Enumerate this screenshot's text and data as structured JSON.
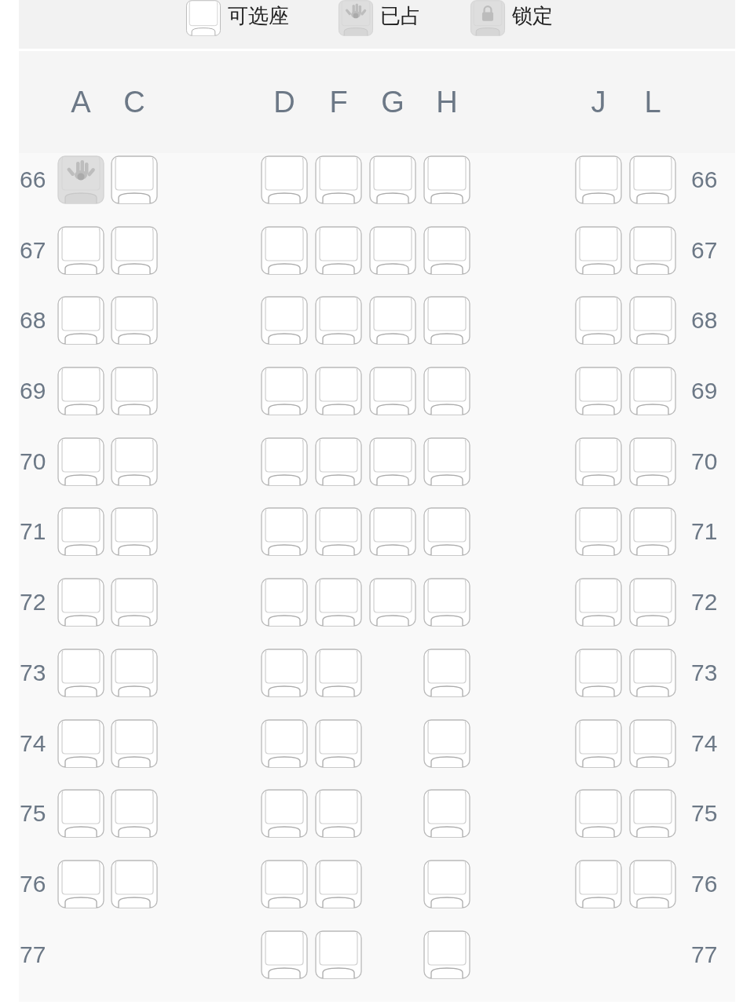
{
  "legend": [
    {
      "kind": "available",
      "label": "可选座"
    },
    {
      "kind": "occupied",
      "label": "已占"
    },
    {
      "kind": "locked",
      "label": "锁定"
    }
  ],
  "column_groups": [
    [
      "A",
      "C"
    ],
    [
      "D",
      "F",
      "G",
      "H"
    ],
    [
      "J",
      "L"
    ]
  ],
  "rows": [
    {
      "left_number": "66",
      "right_number": "66",
      "blocks": [
        [
          {
            "kind": "seat",
            "occupied": true
          },
          {
            "kind": "seat",
            "occupied": false
          }
        ],
        [
          {
            "kind": "seat",
            "occupied": false
          },
          {
            "kind": "seat",
            "occupied": false
          },
          {
            "kind": "seat",
            "occupied": false
          },
          {
            "kind": "seat",
            "occupied": false
          }
        ],
        [
          {
            "kind": "seat",
            "occupied": false
          },
          {
            "kind": "seat",
            "occupied": false
          }
        ]
      ]
    },
    {
      "left_number": "67",
      "right_number": "67",
      "blocks": [
        [
          {
            "kind": "seat",
            "occupied": false
          },
          {
            "kind": "seat",
            "occupied": false
          }
        ],
        [
          {
            "kind": "seat",
            "occupied": false
          },
          {
            "kind": "seat",
            "occupied": false
          },
          {
            "kind": "seat",
            "occupied": false
          },
          {
            "kind": "seat",
            "occupied": false
          }
        ],
        [
          {
            "kind": "seat",
            "occupied": false
          },
          {
            "kind": "seat",
            "occupied": false
          }
        ]
      ]
    },
    {
      "left_number": "68",
      "right_number": "68",
      "blocks": [
        [
          {
            "kind": "seat",
            "occupied": false
          },
          {
            "kind": "seat",
            "occupied": false
          }
        ],
        [
          {
            "kind": "seat",
            "occupied": false
          },
          {
            "kind": "seat",
            "occupied": false
          },
          {
            "kind": "seat",
            "occupied": false
          },
          {
            "kind": "seat",
            "occupied": false
          }
        ],
        [
          {
            "kind": "seat",
            "occupied": false
          },
          {
            "kind": "seat",
            "occupied": false
          }
        ]
      ]
    },
    {
      "left_number": "69",
      "right_number": "69",
      "blocks": [
        [
          {
            "kind": "seat",
            "occupied": false
          },
          {
            "kind": "seat",
            "occupied": false
          }
        ],
        [
          {
            "kind": "seat",
            "occupied": false
          },
          {
            "kind": "seat",
            "occupied": false
          },
          {
            "kind": "seat",
            "occupied": false
          },
          {
            "kind": "seat",
            "occupied": false
          }
        ],
        [
          {
            "kind": "seat",
            "occupied": false
          },
          {
            "kind": "seat",
            "occupied": false
          }
        ]
      ]
    },
    {
      "left_number": "70",
      "right_number": "70",
      "blocks": [
        [
          {
            "kind": "seat",
            "occupied": false
          },
          {
            "kind": "seat",
            "occupied": false
          }
        ],
        [
          {
            "kind": "seat",
            "occupied": false
          },
          {
            "kind": "seat",
            "occupied": false
          },
          {
            "kind": "seat",
            "occupied": false
          },
          {
            "kind": "seat",
            "occupied": false
          }
        ],
        [
          {
            "kind": "seat",
            "occupied": false
          },
          {
            "kind": "seat",
            "occupied": false
          }
        ]
      ]
    },
    {
      "left_number": "71",
      "right_number": "71",
      "blocks": [
        [
          {
            "kind": "seat",
            "occupied": false
          },
          {
            "kind": "seat",
            "occupied": false
          }
        ],
        [
          {
            "kind": "seat",
            "occupied": false
          },
          {
            "kind": "seat",
            "occupied": false
          },
          {
            "kind": "seat",
            "occupied": false
          },
          {
            "kind": "seat",
            "occupied": false
          }
        ],
        [
          {
            "kind": "seat",
            "occupied": false
          },
          {
            "kind": "seat",
            "occupied": false
          }
        ]
      ]
    },
    {
      "left_number": "72",
      "right_number": "72",
      "blocks": [
        [
          {
            "kind": "seat",
            "occupied": false
          },
          {
            "kind": "seat",
            "occupied": false
          }
        ],
        [
          {
            "kind": "seat",
            "occupied": false
          },
          {
            "kind": "seat",
            "occupied": false
          },
          {
            "kind": "seat",
            "occupied": false
          },
          {
            "kind": "seat",
            "occupied": false
          }
        ],
        [
          {
            "kind": "seat",
            "occupied": false
          },
          {
            "kind": "seat",
            "occupied": false
          }
        ]
      ]
    },
    {
      "left_number": "73",
      "right_number": "73",
      "blocks": [
        [
          {
            "kind": "seat",
            "occupied": false
          },
          {
            "kind": "seat",
            "occupied": false
          }
        ],
        [
          {
            "kind": "seat",
            "occupied": false
          },
          {
            "kind": "seat",
            "occupied": false
          },
          {
            "kind": "gap"
          },
          {
            "kind": "seat",
            "occupied": false
          }
        ],
        [
          {
            "kind": "seat",
            "occupied": false
          },
          {
            "kind": "seat",
            "occupied": false
          }
        ]
      ]
    },
    {
      "left_number": "74",
      "right_number": "74",
      "blocks": [
        [
          {
            "kind": "seat",
            "occupied": false
          },
          {
            "kind": "seat",
            "occupied": false
          }
        ],
        [
          {
            "kind": "seat",
            "occupied": false
          },
          {
            "kind": "seat",
            "occupied": false
          },
          {
            "kind": "gap"
          },
          {
            "kind": "seat",
            "occupied": false
          }
        ],
        [
          {
            "kind": "seat",
            "occupied": false
          },
          {
            "kind": "seat",
            "occupied": false
          }
        ]
      ]
    },
    {
      "left_number": "75",
      "right_number": "75",
      "blocks": [
        [
          {
            "kind": "seat",
            "occupied": false
          },
          {
            "kind": "seat",
            "occupied": false
          }
        ],
        [
          {
            "kind": "seat",
            "occupied": false
          },
          {
            "kind": "seat",
            "occupied": false
          },
          {
            "kind": "gap"
          },
          {
            "kind": "seat",
            "occupied": false
          }
        ],
        [
          {
            "kind": "seat",
            "occupied": false
          },
          {
            "kind": "seat",
            "occupied": false
          }
        ]
      ]
    },
    {
      "left_number": "76",
      "right_number": "76",
      "blocks": [
        [
          {
            "kind": "seat",
            "occupied": false
          },
          {
            "kind": "seat",
            "occupied": false
          }
        ],
        [
          {
            "kind": "seat",
            "occupied": false
          },
          {
            "kind": "seat",
            "occupied": false
          },
          {
            "kind": "gap"
          },
          {
            "kind": "seat",
            "occupied": false
          }
        ],
        [
          {
            "kind": "seat",
            "occupied": false
          },
          {
            "kind": "seat",
            "occupied": false
          }
        ]
      ]
    },
    {
      "left_number": "77",
      "right_number": "77",
      "blocks": [
        [
          {
            "kind": "gap"
          },
          {
            "kind": "gap"
          }
        ],
        [
          {
            "kind": "seat",
            "occupied": false
          },
          {
            "kind": "seat",
            "occupied": false
          },
          {
            "kind": "gap"
          },
          {
            "kind": "seat",
            "occupied": false
          }
        ],
        [
          {
            "kind": "gap"
          },
          {
            "kind": "gap"
          }
        ]
      ]
    }
  ]
}
